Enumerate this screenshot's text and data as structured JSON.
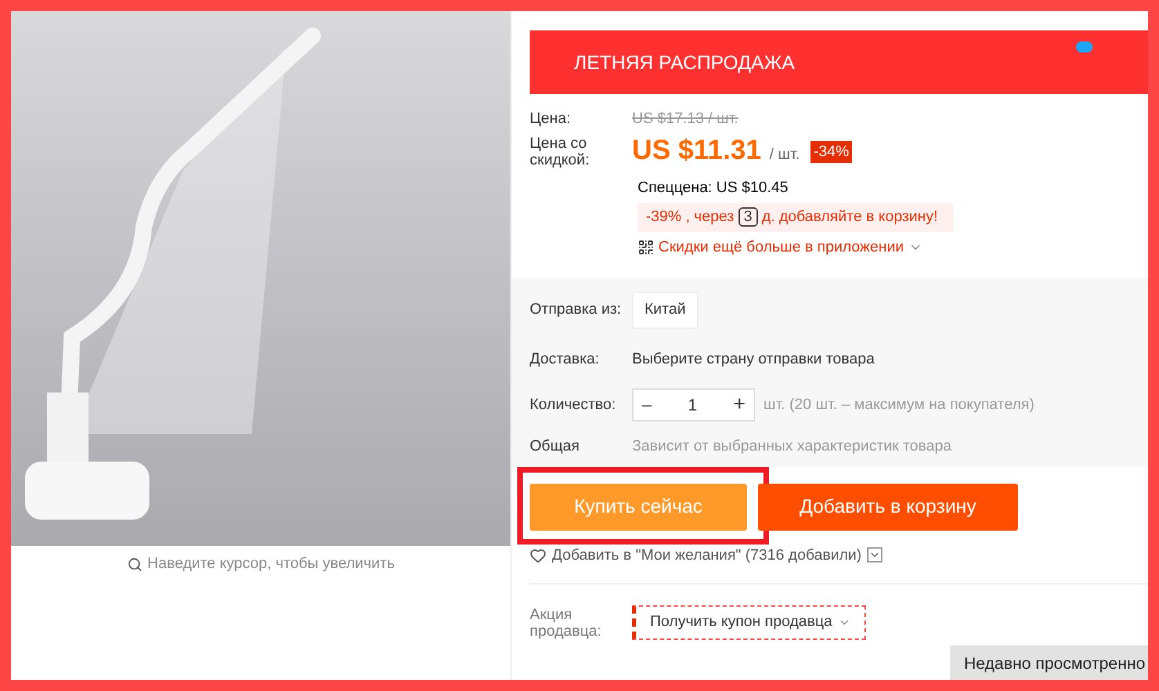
{
  "image_caption": "Наведите курсор, чтобы увеличить",
  "banner": "ЛЕТНЯЯ РАСПРОДАЖА",
  "price": {
    "label": "Цена:",
    "old": "US $17.13 / шт."
  },
  "discount_price": {
    "label": "Цена со скидкой:",
    "value": "US $11.31",
    "unit": "/ шт.",
    "badge": "-34%"
  },
  "special": {
    "text": "Спеццена: US $10.45",
    "percent": "-39%",
    "before_days": ", через",
    "days": "3",
    "after_days": "д. добавляйте в корзину!"
  },
  "app_promo": "Скидки ещё больше в приложении",
  "shipping_from": {
    "label": "Отправка из:",
    "options": [
      {
        "label": "Китай",
        "selected": false
      }
    ]
  },
  "delivery": {
    "label": "Доставка:",
    "value": "Выберите страну отправки товара"
  },
  "quantity": {
    "label": "Количество:",
    "minus": "–",
    "value": "1",
    "plus": "+",
    "note": "шт. (20 шт. – максимум на покупателя)"
  },
  "total": {
    "label": "Общая",
    "value": "Зависит от выбранных характеристик товара"
  },
  "buttons": [
    {
      "label": "Купить сейчас",
      "kind": "buy",
      "highlighted": true
    },
    {
      "label": "Добавить в корзину",
      "kind": "cart",
      "highlighted": false
    }
  ],
  "wishlist": "Добавить в \"Мои желания\" (7316 добавили)",
  "seller_promo": {
    "label": "Акция продавца:",
    "coupon": "Получить купон продавца"
  },
  "recent_tab": "Недавно просмотренно"
}
